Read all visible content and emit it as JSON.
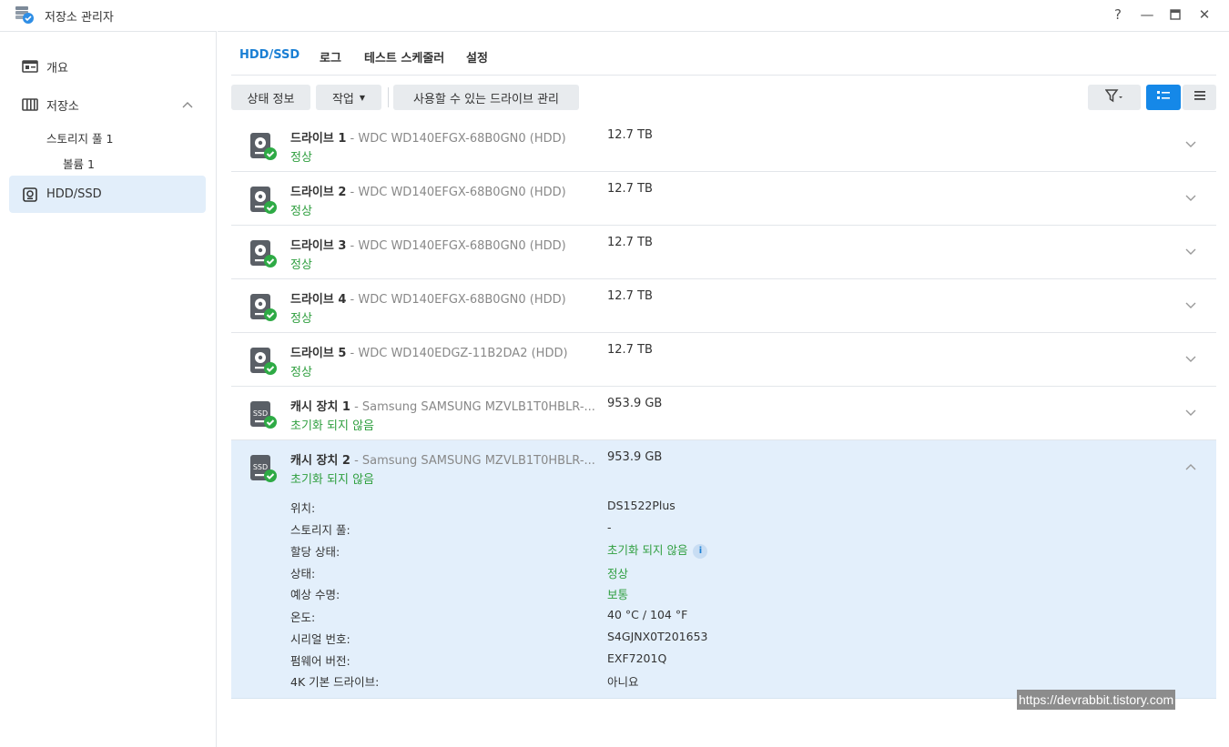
{
  "window": {
    "title": "저장소 관리자",
    "controls": {
      "help": "?",
      "minimize": "—",
      "maximize": "▭",
      "close": "✕"
    }
  },
  "sidebar": {
    "overview": "개요",
    "storage": "저장소",
    "pool": "스토리지 풀 1",
    "volume": "볼륨 1",
    "hdd": "HDD/SSD"
  },
  "tabs": [
    "HDD/SSD",
    "로그",
    "테스트 스케줄러",
    "설정"
  ],
  "toolbar": {
    "status_info": "상태 정보",
    "action": "작업",
    "manage_drives": "사용할 수 있는 드라이브 관리"
  },
  "drives": [
    {
      "name": "드라이브 1",
      "model": " - WDC WD140EFGX-68B0GN0 (HDD)",
      "status": "정상",
      "size": "12.7 TB",
      "icon": "hdd-icon"
    },
    {
      "name": "드라이브 2",
      "model": " - WDC WD140EFGX-68B0GN0 (HDD)",
      "status": "정상",
      "size": "12.7 TB",
      "icon": "hdd-icon"
    },
    {
      "name": "드라이브 3",
      "model": " - WDC WD140EFGX-68B0GN0 (HDD)",
      "status": "정상",
      "size": "12.7 TB",
      "icon": "hdd-icon"
    },
    {
      "name": "드라이브 4",
      "model": " - WDC WD140EFGX-68B0GN0 (HDD)",
      "status": "정상",
      "size": "12.7 TB",
      "icon": "hdd-icon"
    },
    {
      "name": "드라이브 5",
      "model": " - WDC WD140EDGZ-11B2DA2 (HDD)",
      "status": "정상",
      "size": "12.7 TB",
      "icon": "hdd-icon"
    },
    {
      "name": "캐시 장치 1",
      "model": " - Samsung SAMSUNG MZVLB1T0HBLR-...",
      "status": "초기화 되지 않음",
      "size": "953.9 GB",
      "icon": "ssd-icon"
    },
    {
      "name": "캐시 장치 2",
      "model": " - Samsung SAMSUNG MZVLB1T0HBLR-...",
      "status": "초기화 되지 않음",
      "size": "953.9 GB",
      "icon": "ssd-icon"
    }
  ],
  "details": {
    "location_label": "위치:",
    "location": "DS1522Plus",
    "pool_label": "스토리지 풀:",
    "pool": "-",
    "alloc_label": "할당 상태:",
    "alloc": "초기화 되지 않음",
    "state_label": "상태:",
    "state": "정상",
    "life_label": "예상 수명:",
    "life": "보통",
    "temp_label": "온도:",
    "temp": "40 °C / 104 °F",
    "serial_label": "시리얼 번호:",
    "serial": "S4GJNX0T201653",
    "firmware_label": "펌웨어 버전:",
    "firmware": "EXF7201Q",
    "native4k_label": "4K 기본 드라이브:",
    "native4k": "아니요"
  },
  "colors": {
    "accent": "#1588e8",
    "ok": "#2e9e3e",
    "selected": "#e3effb"
  },
  "watermark": "https://devrabbit.tistory.com"
}
